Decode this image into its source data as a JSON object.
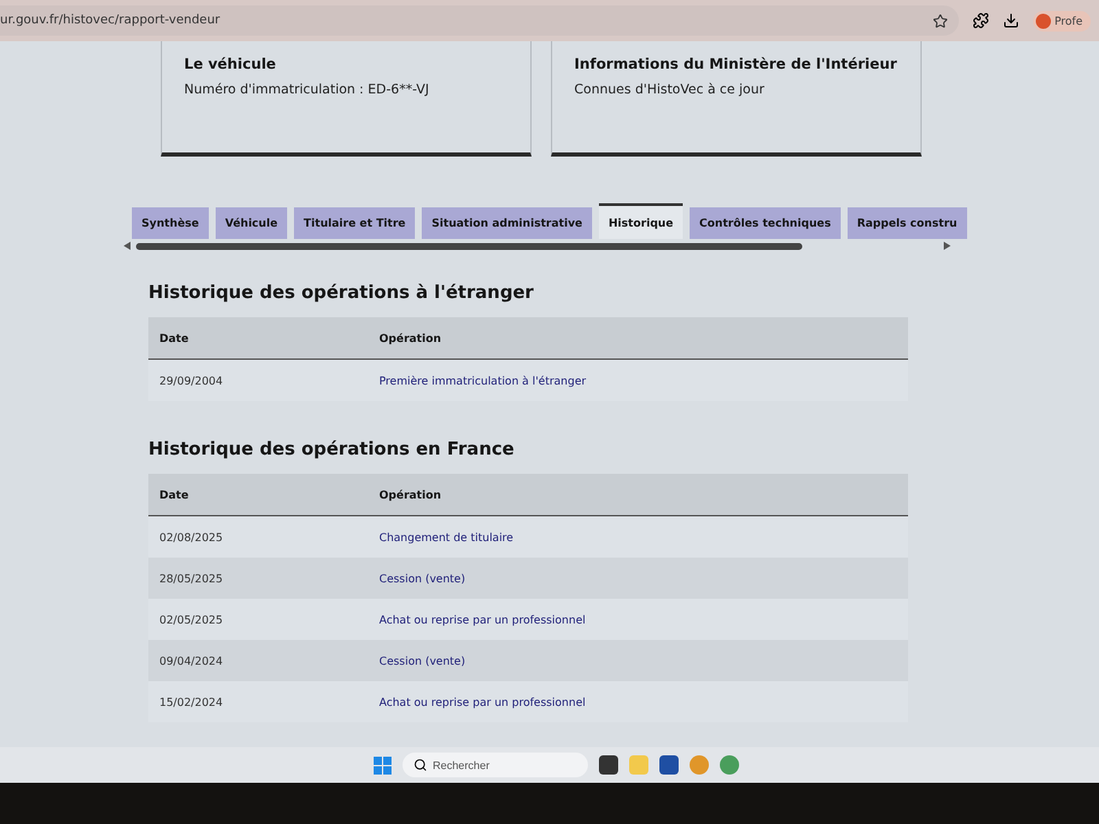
{
  "browser": {
    "url": "ur.gouv.fr/histovec/rapport-vendeur",
    "profile": "Profe"
  },
  "cards": [
    {
      "title": "Le véhicule",
      "text": "Numéro d'immatriculation : ED-6**-VJ"
    },
    {
      "title": "Informations du Ministère de l'Intérieur",
      "text": "Connues d'HistoVec à ce jour"
    }
  ],
  "tabs": [
    {
      "label": "Synthèse",
      "selected": false
    },
    {
      "label": "Véhicule",
      "selected": false
    },
    {
      "label": "Titulaire et Titre",
      "selected": false
    },
    {
      "label": "Situation administrative",
      "selected": false
    },
    {
      "label": "Historique",
      "selected": true
    },
    {
      "label": "Contrôles techniques",
      "selected": false
    },
    {
      "label": "Rappels constru",
      "selected": false
    }
  ],
  "sections": [
    {
      "title": "Historique des opérations à l'étranger",
      "columns": [
        "Date",
        "Opération"
      ],
      "rows": [
        [
          "29/09/2004",
          "Première immatriculation à l'étranger"
        ]
      ]
    },
    {
      "title": "Historique des opérations en France",
      "columns": [
        "Date",
        "Opération"
      ],
      "rows": [
        [
          "02/08/2025",
          "Changement de titulaire"
        ],
        [
          "28/05/2025",
          "Cession (vente)"
        ],
        [
          "02/05/2025",
          "Achat ou reprise par un professionnel"
        ],
        [
          "09/04/2024",
          "Cession (vente)"
        ],
        [
          "15/02/2024",
          "Achat ou reprise par un professionnel"
        ]
      ]
    }
  ],
  "taskbar": {
    "search": {
      "placeholder": "Rechercher"
    }
  }
}
